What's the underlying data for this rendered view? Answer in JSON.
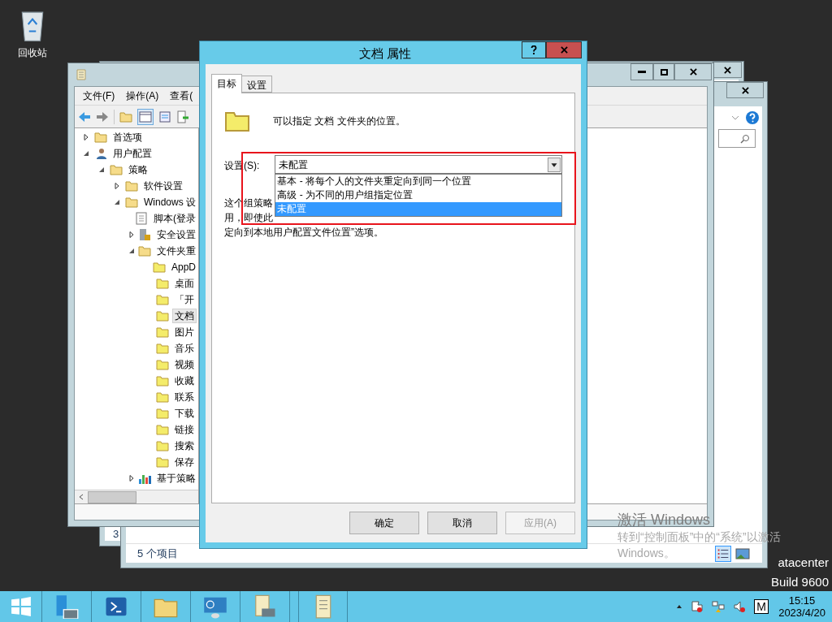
{
  "desktop": {
    "icons": [
      {
        "label": "回收站"
      }
    ],
    "edition_lines": [
      "atacenter",
      "Build 9600"
    ],
    "activation": {
      "title": "激活 Windows",
      "lines": [
        "转到“控制面板”中的“系统”以激活",
        "Windows。"
      ]
    }
  },
  "window_back": {
    "status": "3"
  },
  "window_explorer": {
    "status": "5 个项目"
  },
  "editor": {
    "menu": [
      "文件(F)",
      "操作(A)",
      "查看("
    ],
    "tree": [
      {
        "label": "首选项",
        "kind": "folder",
        "expanded": false,
        "selected": false
      },
      {
        "label": "用户配置",
        "kind": "user",
        "expanded": true,
        "selected": false,
        "children": [
          {
            "label": "策略",
            "kind": "folder",
            "expanded": true,
            "selected": false,
            "children": [
              {
                "label": "软件设置",
                "kind": "folder",
                "expanded": false,
                "selected": false
              },
              {
                "label": "Windows 设",
                "kind": "folder",
                "expanded": true,
                "selected": false,
                "children": [
                  {
                    "label": "脚本(登录",
                    "kind": "script",
                    "selected": false
                  },
                  {
                    "label": "安全设置",
                    "kind": "security",
                    "expanded": false,
                    "selected": false
                  },
                  {
                    "label": "文件夹重",
                    "kind": "folder",
                    "expanded": true,
                    "selected": false,
                    "children": [
                      {
                        "label": "AppD",
                        "kind": "redirect",
                        "selected": false
                      },
                      {
                        "label": "桌面",
                        "kind": "redirect",
                        "selected": false
                      },
                      {
                        "label": "「开",
                        "kind": "redirect",
                        "selected": false
                      },
                      {
                        "label": "文档",
                        "kind": "redirect",
                        "selected": true
                      },
                      {
                        "label": "图片",
                        "kind": "redirect",
                        "selected": false
                      },
                      {
                        "label": "音乐",
                        "kind": "redirect",
                        "selected": false
                      },
                      {
                        "label": "视频",
                        "kind": "redirect",
                        "selected": false
                      },
                      {
                        "label": "收藏",
                        "kind": "redirect",
                        "selected": false
                      },
                      {
                        "label": "联系",
                        "kind": "redirect",
                        "selected": false
                      },
                      {
                        "label": "下载",
                        "kind": "redirect",
                        "selected": false
                      },
                      {
                        "label": "链接",
                        "kind": "redirect",
                        "selected": false
                      },
                      {
                        "label": "搜索",
                        "kind": "redirect",
                        "selected": false
                      },
                      {
                        "label": "保存",
                        "kind": "redirect",
                        "selected": false
                      }
                    ]
                  },
                  {
                    "label": "基于策略",
                    "kind": "chart",
                    "expanded": false,
                    "selected": false
                  }
                ]
              }
            ]
          }
        ]
      }
    ]
  },
  "dialog": {
    "title": "文档 属性",
    "tabs": [
      {
        "label": "目标",
        "selected": true
      },
      {
        "label": "设置",
        "selected": false
      }
    ],
    "intro": "可以指定 文档 文件夹的位置。",
    "setting_label": "设置(S):",
    "setting_value": "未配置",
    "options": [
      {
        "label": "基本 - 将每个人的文件夹重定向到同一个位置",
        "selected": false
      },
      {
        "label": "高级 - 为不同的用户组指定位置",
        "selected": false
      },
      {
        "label": "未配置",
        "selected": true
      }
    ],
    "description_lines": [
      "这个组策略",
      "用，即使此",
      "定向到本地用户配置文件位置”选项。"
    ],
    "buttons": [
      {
        "label": "确定",
        "disabled": false
      },
      {
        "label": "取消",
        "disabled": false
      },
      {
        "label": "应用(A)",
        "disabled": true
      }
    ]
  },
  "taskbar": {
    "ime": "M",
    "time": "15:15",
    "date": "2023/4/20"
  }
}
